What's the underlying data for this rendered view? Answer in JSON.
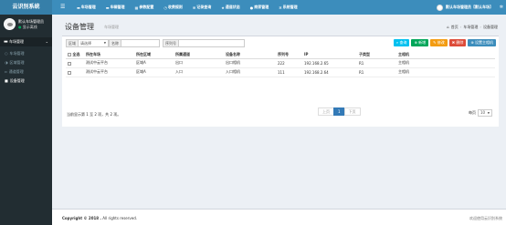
{
  "app": {
    "title": "云识别系统",
    "menu_icon": "hamburger-icon"
  },
  "topnav": [
    {
      "icon": "car-icon",
      "label": "车场管理"
    },
    {
      "icon": "car-icon",
      "label": "车辆管理"
    },
    {
      "icon": "grid-icon",
      "label": "参数配置"
    },
    {
      "icon": "clock-icon",
      "label": "收费规则"
    },
    {
      "icon": "list-icon",
      "label": "记录查询"
    },
    {
      "icon": "star-icon",
      "label": "通道状态"
    },
    {
      "icon": "user-icon",
      "label": "商家管理"
    },
    {
      "icon": "gear-icon",
      "label": "系统管理"
    }
  ],
  "topbar_user": "默认车场管理员【默认车场】",
  "sidebar": {
    "user_name": "默认车场管理员",
    "user_status": "显示离线",
    "section": "车场管理",
    "items": [
      {
        "label": "车场管理",
        "active": false
      },
      {
        "label": "区域管理",
        "active": false
      },
      {
        "label": "通道管理",
        "active": false
      },
      {
        "label": "设备管理",
        "active": true
      }
    ]
  },
  "page": {
    "title": "设备管理",
    "subtitle": "车场管理",
    "breadcrumb": [
      "首页",
      "车场管理",
      "设备管理"
    ]
  },
  "search": {
    "area_label": "区域",
    "area_value": "请选择",
    "name_label": "名称",
    "name_value": "",
    "serial_label": "序列号",
    "serial_value": ""
  },
  "buttons": {
    "search": "查询",
    "add": "新增",
    "edit": "修改",
    "delete": "删除",
    "set_master": "设置主相机"
  },
  "table": {
    "headers": [
      "全选",
      "所在车场",
      "所在区域",
      "所属通道",
      "设备名称",
      "序列号",
      "IP",
      "子类型",
      "主相机"
    ],
    "rows": [
      [
        "",
        "测试中云平台",
        "区域A",
        "出口",
        "出口相机",
        "222",
        "192.168.2.65",
        "R1",
        "主相机"
      ],
      [
        "",
        "测试中云平台",
        "区域A",
        "入口",
        "入口相机",
        "111",
        "192.168.2.64",
        "R1",
        "主相机"
      ]
    ]
  },
  "pagination": {
    "info": "当前显示第 1 至 2 项，共 2 项。",
    "prev": "上页",
    "current": "1",
    "next": "下页",
    "per_page_label": "每页",
    "per_page_value": "10"
  },
  "footer": {
    "copyright": "Copyright © 2018 .",
    "rights": " All rights reserved.",
    "welcome": "欢迎使用云识别系统"
  }
}
